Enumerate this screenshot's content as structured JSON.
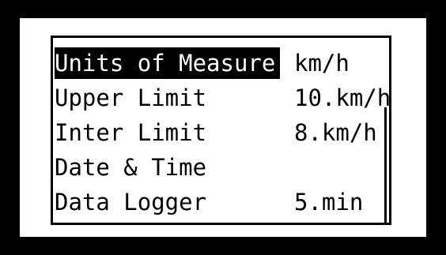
{
  "menu": {
    "items": [
      {
        "label": "Units of Measure",
        "value": "km/h",
        "selected": true
      },
      {
        "label": "Upper Limit",
        "value": "10.km/h",
        "selected": false
      },
      {
        "label": "Inter Limit",
        "value": "8.km/h",
        "selected": false
      },
      {
        "label": "Date & Time",
        "value": "",
        "selected": false
      },
      {
        "label": "Data Logger",
        "value": "5.min",
        "selected": false
      }
    ]
  },
  "colors": {
    "frame": "#000000",
    "screen": "#ffffff",
    "highlight": "#000000",
    "highlight_text": "#ffffff"
  }
}
